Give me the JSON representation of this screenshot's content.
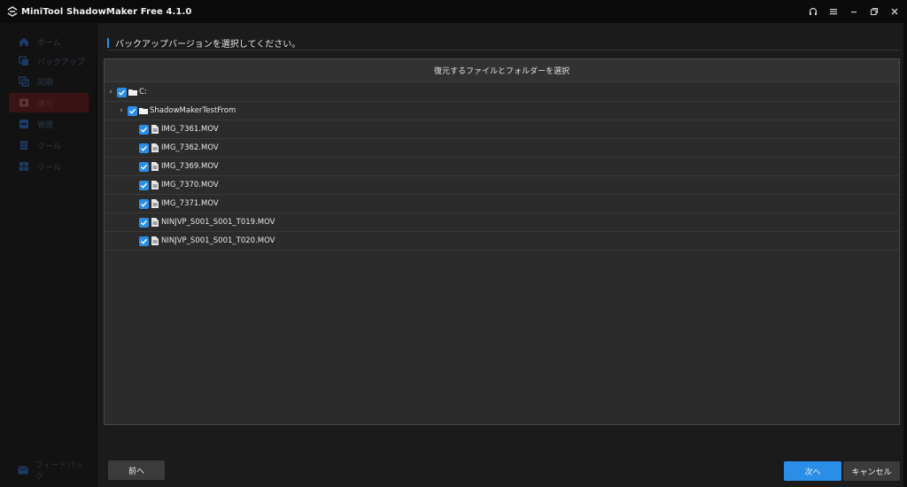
{
  "app": {
    "title": "MiniTool ShadowMaker Free 4.1.0"
  },
  "window_controls": [
    "headset-icon",
    "menu-icon",
    "minimize-icon",
    "restore-icon",
    "close-icon"
  ],
  "sidebar": {
    "items": [
      {
        "icon": "home-icon",
        "label": "ホーム",
        "active": false
      },
      {
        "icon": "backup-icon",
        "label": "バックアップ",
        "active": false
      },
      {
        "icon": "sync-icon",
        "label": "同期",
        "active": false
      },
      {
        "icon": "restore-icon",
        "label": "復元",
        "active": true
      },
      {
        "icon": "manage-icon",
        "label": "管理",
        "active": false
      },
      {
        "icon": "tools-icon",
        "label": "ツール",
        "active": false
      },
      {
        "icon": "vhd-icon",
        "label": "ツール",
        "active": false
      }
    ],
    "bottom": {
      "icon": "mail-icon",
      "label": "フィードバック"
    }
  },
  "main": {
    "section_title": "バックアップバージョンを選択してください。",
    "panel_title": "復元するファイルとフォルダーを選択",
    "tree": [
      {
        "label": "C:",
        "type": "folder",
        "level": 0,
        "expandable": true,
        "checked": true
      },
      {
        "label": "ShadowMakerTestFrom",
        "type": "folder",
        "level": 1,
        "expandable": true,
        "checked": true
      },
      {
        "label": "IMG_7361.MOV",
        "type": "file",
        "level": 2,
        "expandable": false,
        "checked": true
      },
      {
        "label": "IMG_7362.MOV",
        "type": "file",
        "level": 2,
        "expandable": false,
        "checked": true
      },
      {
        "label": "IMG_7369.MOV",
        "type": "file",
        "level": 2,
        "expandable": false,
        "checked": true
      },
      {
        "label": "IMG_7370.MOV",
        "type": "file",
        "level": 2,
        "expandable": false,
        "checked": true
      },
      {
        "label": "IMG_7371.MOV",
        "type": "file",
        "level": 2,
        "expandable": false,
        "checked": true
      },
      {
        "label": "NINJVP_S001_S001_T019.MOV",
        "type": "file",
        "level": 2,
        "expandable": false,
        "checked": true
      },
      {
        "label": "NINJVP_S001_S001_T020.MOV",
        "type": "file",
        "level": 2,
        "expandable": false,
        "checked": true
      }
    ]
  },
  "footer": {
    "back_label": "前へ",
    "next_label": "次へ",
    "cancel_label": "キャンセル"
  },
  "colors": {
    "accent": "#2b8ee6",
    "active_nav": "#3a1414",
    "panel_bg": "#2b2b2b"
  }
}
